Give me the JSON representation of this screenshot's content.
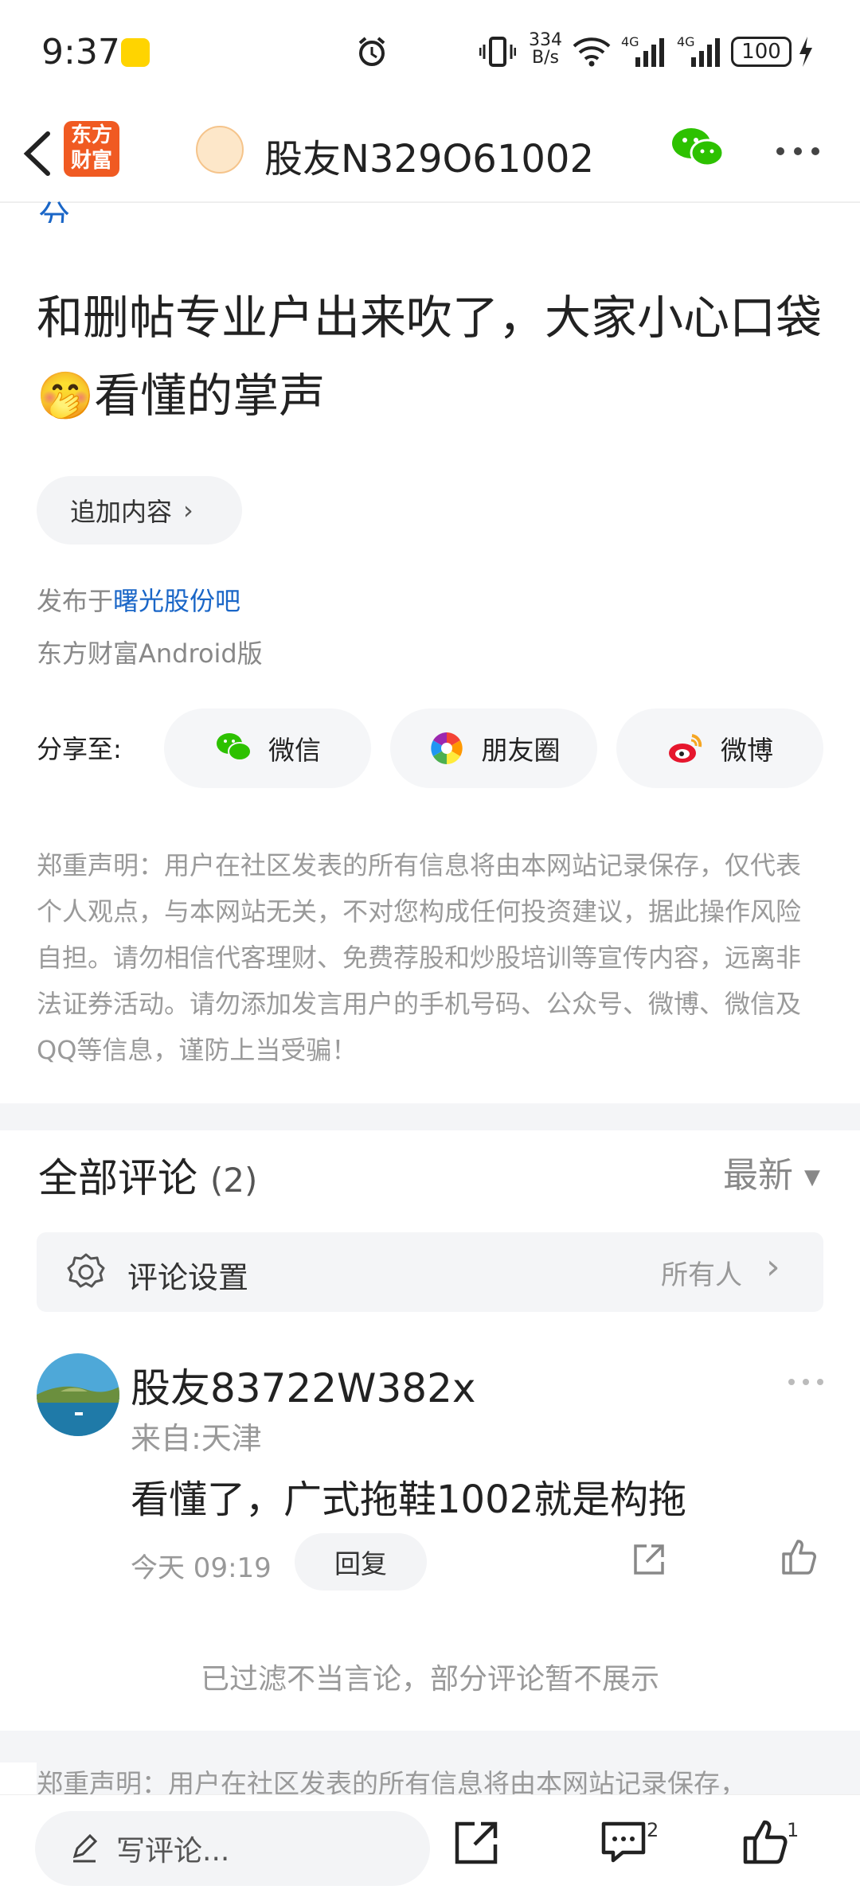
{
  "status_bar": {
    "time": "9:37",
    "net_speed_top": "334",
    "net_speed_bottom": "B/s",
    "battery": "100"
  },
  "nav": {
    "logo_line1": "东方",
    "logo_line2": "财富",
    "title": "股友N329O61002"
  },
  "post": {
    "cut_text": "分",
    "title": "和删帖专业户出来吹了，大家小心口袋🤭看懂的掌声",
    "add_content": "追加内容",
    "published_prefix": "发布于",
    "published_bar": "曙光股份吧",
    "client": "东方财富Android版"
  },
  "share": {
    "label": "分享至:",
    "items": [
      {
        "label": "微信"
      },
      {
        "label": "朋友圈"
      },
      {
        "label": "微博"
      }
    ]
  },
  "disclaimer": "郑重声明：用户在社区发表的所有信息将由本网站记录保存，仅代表个人观点，与本网站无关，不对您构成任何投资建议，据此操作风险自担。请勿相信代客理财、免费荐股和炒股培训等宣传内容，远离非法证券活动。请勿添加发言用户的手机号码、公众号、微博、微信及QQ等信息，谨防上当受骗！",
  "comments": {
    "title": "全部评论",
    "count": "(2)",
    "sort": "最新",
    "settings_label": "评论设置",
    "settings_value": "所有人",
    "items": [
      {
        "user": "股友83722W382x",
        "location": "来自:天津",
        "text": "看懂了，广式拖鞋1002就是构拖",
        "time": "今天 09:19",
        "reply": "回复"
      }
    ],
    "filtered_notice": "已过滤不当言论，部分评论暂不展示"
  },
  "disclaimer2": "郑重声明：用户在社区发表的所有信息将由本网站记录保存，",
  "bottom_bar": {
    "write_placeholder": "写评论...",
    "comment_badge": "2",
    "like_badge": "1"
  }
}
